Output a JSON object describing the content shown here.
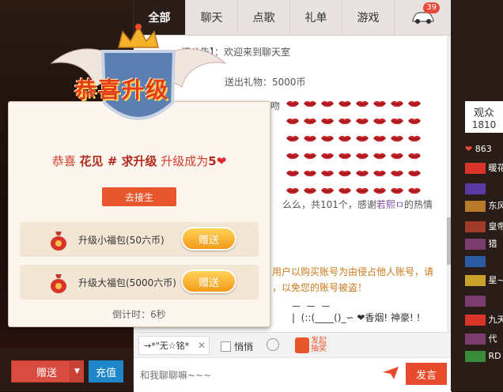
{
  "left": {
    "gift_button": "赠送",
    "recharge_button": "充值"
  },
  "chat": {
    "tabs": [
      "全部",
      "聊天",
      "点歌",
      "礼单",
      "游戏"
    ],
    "car_badge": "39",
    "messages": {
      "announcement": "间公告】：欢迎来到聊天室",
      "line2": "送出礼物：5000币",
      "line3": "送了×了飞吻",
      "summary_prefix": "么么，共101个，感谢",
      "summary_name": "若熙ㅁ",
      "summary_suffix": "的热情",
      "warn1": "用户以购买账号为由侵占他人账号，请",
      "warn2": "，以免您的账号被盗！",
      "ascii": "ㅡ  ㅡ  ㅡ\n|  (::(____()_∽ ❤香烟! 神豪! !"
    },
    "target_chip": "→*\"无☆铭*",
    "whisper_label": "悄悄",
    "lottery_label_1": "发起",
    "lottery_label_2": "抽奖",
    "input_placeholder": "和我聊聊嘛~~~",
    "send_button": "发言"
  },
  "audience": {
    "title": "观众",
    "count": "1810",
    "row1_num": "863",
    "names": [
      "暖花",
      "东风",
      "皇帝",
      "猎",
      "星~",
      "九天",
      "代",
      "RD"
    ]
  },
  "popup": {
    "emblem_text": "恭喜升级",
    "congrats_prefix": "恭喜",
    "user_name": "花见 # 求升级",
    "congrats_mid": "升级成为",
    "level": "5",
    "heart": "❤",
    "goto_button": "去接生",
    "gifts": [
      {
        "name": "升级小福包(50六币)",
        "button": "赠送"
      },
      {
        "name": "升级大福包(5000六币)",
        "button": "赠送"
      }
    ],
    "countdown": "倒计时：6秒"
  },
  "colors": {
    "accent": "#e8572c",
    "tab_active_bg": "#2b1d18",
    "recharge": "#1e86c9"
  }
}
